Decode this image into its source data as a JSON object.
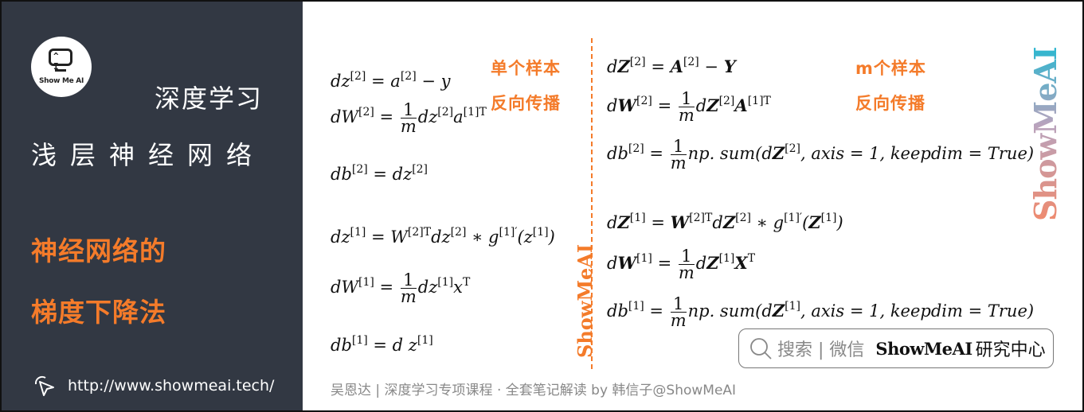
{
  "sidebar": {
    "logo_text": "Show Me AI",
    "subtitle": "深度学习",
    "title": "浅层神经网络",
    "topic_line1": "神经网络的",
    "topic_line2": "梯度下降法",
    "url": "http://www.showmeai.tech/"
  },
  "single_sample": {
    "label_line1": "单个样本",
    "label_line2": "反向传播",
    "equations": [
      "dz[2] = a[2] − y",
      "dW[2] = (1/m) dz[2] a[1]T",
      "db[2] = dz[2]",
      "dz[1] = W[2]T dz[2] ∗ g[1]′(z[1])",
      "dW[1] = (1/m) dz[1] xT",
      "db[1] = d z[1]"
    ]
  },
  "m_samples": {
    "label_line1": "m个样本",
    "label_line2": "反向传播",
    "equations": [
      "dZ[2] = A[2] − Y",
      "dW[2] = (1/m) dZ[2] A[1]T",
      "db[2] = (1/m) np.sum(dZ[2], axis = 1, keepdim = True)",
      "dZ[1] = W[2]T dZ[2] ∗ g[1]′(Z[1])",
      "dW[1] = (1/m) dZ[1] XT",
      "db[1] = (1/m) np.sum(dZ[1], axis = 1, keepdim = True)"
    ]
  },
  "watermark": "ShowMeAI",
  "search": {
    "placeholder": "搜索 | 微信",
    "brand": "ShowMeAI",
    "brand_cn": "研究中心"
  },
  "footer": "吴恩达 | 深度学习专项课程 · 全套笔记解读  by 韩信子@ShowMeAI",
  "colors": {
    "accent": "#f47b2a",
    "sidebar_bg": "#323843"
  }
}
